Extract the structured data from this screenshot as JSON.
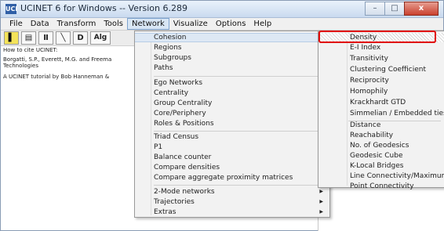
{
  "window": {
    "title": "UCINET 6 for Windows -- Version 6.289",
    "icon": "UCI",
    "controls": {
      "minimize": "–",
      "maximize": "□",
      "close": "x"
    }
  },
  "menubar": {
    "items": [
      {
        "label": "File"
      },
      {
        "label": "Data"
      },
      {
        "label": "Transform"
      },
      {
        "label": "Tools"
      },
      {
        "label": "Network"
      },
      {
        "label": "Visualize"
      },
      {
        "label": "Options"
      },
      {
        "label": "Help"
      }
    ]
  },
  "toolbar": {
    "buttons": [
      {
        "icon": "spreadsheet-icon",
        "glyph": "▌"
      },
      {
        "icon": "matrix-editor-icon",
        "glyph": "▤"
      },
      {
        "icon": "chart-icon",
        "glyph": "Ⅱ"
      },
      {
        "icon": "line-icon",
        "glyph": "╲"
      },
      {
        "icon": "draw-icon",
        "glyph": "D"
      },
      {
        "icon": "algorithm-icon",
        "glyph": "Alg"
      }
    ]
  },
  "content": {
    "lines": [
      "How to cite UCINET:",
      "Borgatti, S.P., Everett, M.G. and Freema",
      "Technologies",
      "A UCINET tutorial by Bob Hanneman &"
    ]
  },
  "network_menu": {
    "items": [
      {
        "label": "Cohesion",
        "submenu": true,
        "highlighted": true
      },
      {
        "label": "Regions",
        "submenu": true
      },
      {
        "label": "Subgroups",
        "submenu": true
      },
      {
        "label": "Paths",
        "submenu": true
      },
      {
        "label": "Ego Networks",
        "submenu": true
      },
      {
        "label": "Centrality",
        "submenu": true
      },
      {
        "label": "Group Centrality",
        "submenu": true
      },
      {
        "label": "Core/Periphery",
        "submenu": true
      },
      {
        "label": "Roles & Positions",
        "submenu": true
      },
      {
        "label": "Triad Census",
        "submenu": false
      },
      {
        "label": "P1",
        "submenu": false
      },
      {
        "label": "Balance counter",
        "submenu": false
      },
      {
        "label": "Compare densities",
        "submenu": true
      },
      {
        "label": "Compare aggregate proximity matrices",
        "submenu": true
      },
      {
        "label": "2-Mode networks",
        "submenu": true
      },
      {
        "label": "Trajectories",
        "submenu": true
      },
      {
        "label": "Extras",
        "submenu": true
      }
    ]
  },
  "cohesion_submenu": {
    "items": [
      {
        "label": "Density",
        "highlighted": true
      },
      {
        "label": "E-I Index"
      },
      {
        "label": "Transitivity"
      },
      {
        "label": "Clustering Coefficient"
      },
      {
        "label": "Reciprocity"
      },
      {
        "label": "Homophily"
      },
      {
        "label": "Krackhardt GTD"
      },
      {
        "label": "Simmelian / Embedded ties"
      },
      {
        "label": "Distance"
      },
      {
        "label": "Reachability"
      },
      {
        "label": "No. of Geodesics"
      },
      {
        "label": "Geodesic Cube"
      },
      {
        "label": "K-Local Bridges"
      },
      {
        "label": "Line Connectivity/Maximum flow"
      },
      {
        "label": "Point Connectivity"
      }
    ]
  },
  "arrow_glyph": "▶",
  "colors": {
    "highlight_box": "#e00000",
    "menu_highlight": "#dde8f4"
  }
}
